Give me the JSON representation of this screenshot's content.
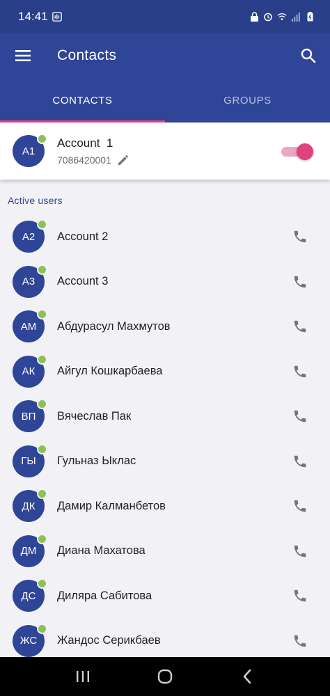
{
  "status_bar": {
    "time": "14:41"
  },
  "app_bar": {
    "title": "Contacts"
  },
  "tabs": [
    {
      "label": "CONTACTS",
      "active": true
    },
    {
      "label": "GROUPS",
      "active": false
    }
  ],
  "account": {
    "initials": "A1",
    "name": "Account  1",
    "phone": "7086420001",
    "toggle_on": true
  },
  "section": {
    "title": "Active users"
  },
  "contacts": [
    {
      "initials": "A2",
      "name": "Account 2"
    },
    {
      "initials": "A3",
      "name": "Account 3"
    },
    {
      "initials": "АМ",
      "name": "Абдурасул Махмутов"
    },
    {
      "initials": "АК",
      "name": "Айгул Кошкарбаева"
    },
    {
      "initials": "ВП",
      "name": "Вячеслав Пак"
    },
    {
      "initials": "ГЫ",
      "name": "Гульназ Ыклас"
    },
    {
      "initials": "ДК",
      "name": "Дамир Калманбетов"
    },
    {
      "initials": "ДМ",
      "name": "Диана Махатова"
    },
    {
      "initials": "ДС",
      "name": "Диляра Сабитова"
    },
    {
      "initials": "ЖС",
      "name": "Жандос Серикбаев"
    }
  ],
  "colors": {
    "primary": "#2f4597",
    "accent": "#e0427c",
    "online": "#8dc152"
  },
  "icons": {
    "menu": "menu-icon",
    "search": "search-icon",
    "edit": "pencil-icon",
    "call": "phone-icon"
  }
}
